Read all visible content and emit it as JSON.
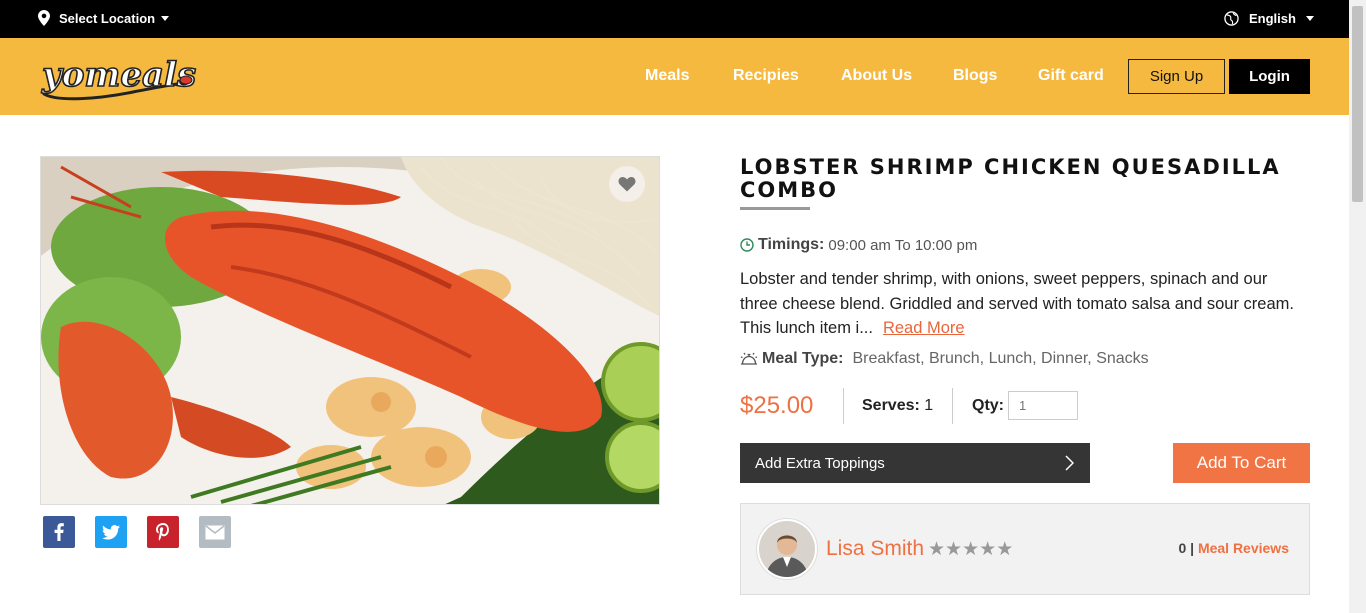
{
  "topbar": {
    "location_label": "Select Location",
    "language_label": "English"
  },
  "header": {
    "brand": "yomeals",
    "nav": [
      "Meals",
      "Recipies",
      "About Us",
      "Blogs",
      "Gift card"
    ],
    "signup_label": "Sign Up",
    "login_label": "Login"
  },
  "product": {
    "title": "LOBSTER SHRIMP CHICKEN QUESADILLA COMBO",
    "timings_label": "Timings:",
    "timings_value": "09:00 am To 10:00 pm",
    "description": "Lobster and tender shrimp, with onions, sweet peppers, spinach and our three cheese blend. Griddled and served with tomato salsa and sour cream. This lunch item i...",
    "read_more": "Read More",
    "meal_type_label": "Meal Type:",
    "meal_type_value": "Breakfast, Brunch, Lunch, Dinner, Snacks",
    "price": "$25.00",
    "serves_label": "Serves:",
    "serves_value": "1",
    "qty_label": "Qty:",
    "qty_placeholder": "1",
    "toppings_label": "Add Extra Toppings",
    "add_to_cart_label": "Add To Cart"
  },
  "share_icons": [
    "facebook-icon",
    "twitter-icon",
    "pinterest-icon",
    "email-icon"
  ],
  "chef": {
    "name": "Lisa Smith",
    "rating_stars": 5,
    "rating_filled": 0,
    "review_count": "0",
    "separator": "|",
    "reviews_label": "Meal Reviews"
  },
  "colors": {
    "header_bg": "#f5b940",
    "accent": "#ef7040",
    "facebook": "#3b5998",
    "twitter": "#1da1f2",
    "pinterest": "#c8232c",
    "email": "#b3bcc3"
  }
}
